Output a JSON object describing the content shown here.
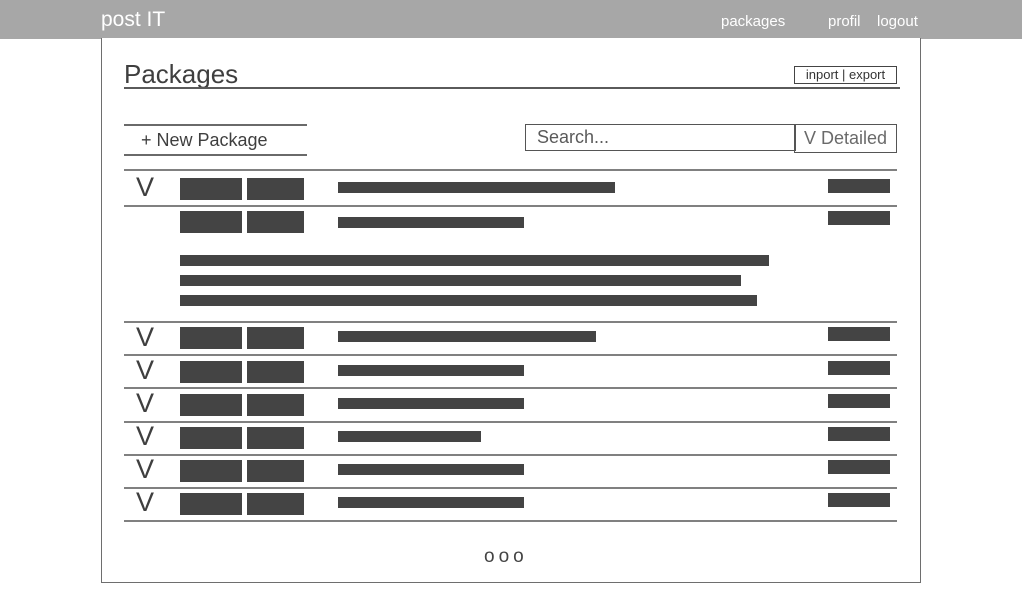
{
  "app": {
    "brand": "post IT"
  },
  "nav": {
    "packages": "packages",
    "profil": "profil",
    "logout": "logout"
  },
  "page": {
    "title": "Packages",
    "import_export_label": "inport | export",
    "new_package_label": "+ New Package",
    "search_placeholder": "Search...",
    "detailed_label": "V Detailed"
  },
  "rows": [
    {
      "chevron": "V",
      "expanded": false
    },
    {
      "chevron": "",
      "expanded": true
    },
    {
      "chevron": "V",
      "expanded": false
    },
    {
      "chevron": "V",
      "expanded": false
    },
    {
      "chevron": "V",
      "expanded": false
    },
    {
      "chevron": "V",
      "expanded": false
    },
    {
      "chevron": "V",
      "expanded": false
    },
    {
      "chevron": "V",
      "expanded": false
    }
  ],
  "pagination": {
    "dots": [
      "o",
      "o",
      "o"
    ]
  },
  "colors": {
    "topbar": "#a7a7a7",
    "placeholder_block": "#444444",
    "divider": "#808080"
  }
}
